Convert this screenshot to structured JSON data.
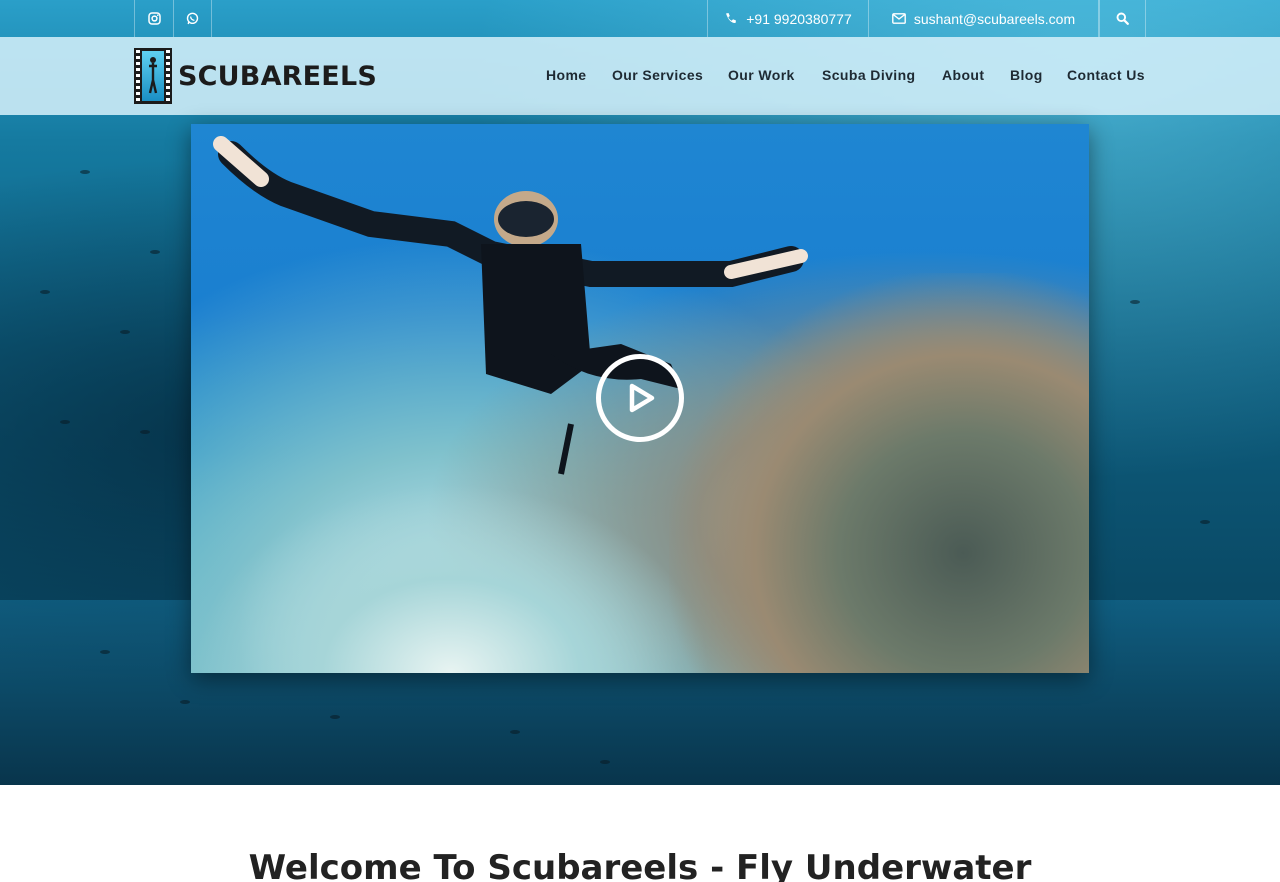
{
  "topbar": {
    "phone": "+91 9920380777",
    "email": "sushant@scubareels.com",
    "social_icons": [
      "instagram-icon",
      "whatsapp-icon"
    ],
    "search_icon": "search-icon"
  },
  "brand": {
    "name": "SCUBAREELS"
  },
  "nav": {
    "items": [
      "Home",
      "Our Services",
      "Our Work",
      "Scuba Diving",
      "About",
      "Blog",
      "Contact Us"
    ]
  },
  "video": {
    "play_icon": "play-icon"
  },
  "section": {
    "title": "Welcome To Scubareels - Fly Underwater"
  },
  "colors": {
    "header_bg": "#d2eef8",
    "nav_text": "#1e2a33",
    "topbar_text": "#ffffff"
  }
}
